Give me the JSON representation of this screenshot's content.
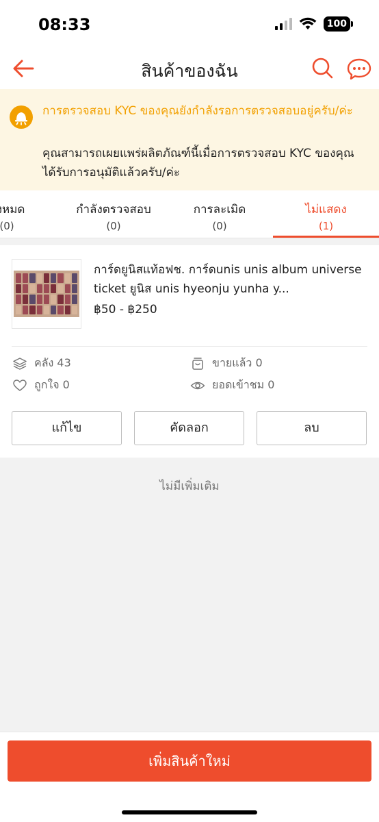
{
  "status_bar": {
    "time": "08:33",
    "battery": "100"
  },
  "header": {
    "title": "สินค้าของฉัน"
  },
  "kyc_banner": {
    "title": "การตรวจสอบ KYC ของคุณยังกำลังรอการตรวจสอบอยู่ครับ/ค่ะ",
    "description": "คุณสามารถเผยแพร่ผลิตภัณฑ์นี้เมื่อการตรวจสอบ KYC ของคุณได้รับการอนุมัติแล้วครับ/ค่ะ"
  },
  "tabs": [
    {
      "label": "ทั้งหมด",
      "count": "(0)"
    },
    {
      "label": "กำลังตรวจสอบ",
      "count": "(0)"
    },
    {
      "label": "การละเมิด",
      "count": "(0)"
    },
    {
      "label": "ไม่แสดง",
      "count": "(1)",
      "active": true
    }
  ],
  "product": {
    "name": "การ์ดยูนิสแท้อฟช. การ์ดunis unis album universe ticket  ยูนิส unis hyeonju yunha y...",
    "price": "฿50 - ฿250",
    "stats": {
      "stock_label": "คลัง 43",
      "sold_label": "ขายแล้ว 0",
      "likes_label": "ถูกใจ 0",
      "views_label": "ยอดเข้าชม 0"
    },
    "actions": {
      "edit": "แก้ไข",
      "copy": "คัดลอก",
      "delete": "ลบ"
    }
  },
  "footer_note": "ไม่มีเพิ่มเติม",
  "bottom": {
    "add_button": "เพิ่มสินค้าใหม่"
  },
  "colors": {
    "accent": "#ee4d2d",
    "kyc_title": "#f2a000",
    "banner_bg": "#fdf6e3"
  },
  "icons": [
    "back-arrow-icon",
    "search-icon",
    "chat-icon",
    "bell-icon",
    "layers-icon",
    "box-icon",
    "heart-icon",
    "eye-icon"
  ]
}
